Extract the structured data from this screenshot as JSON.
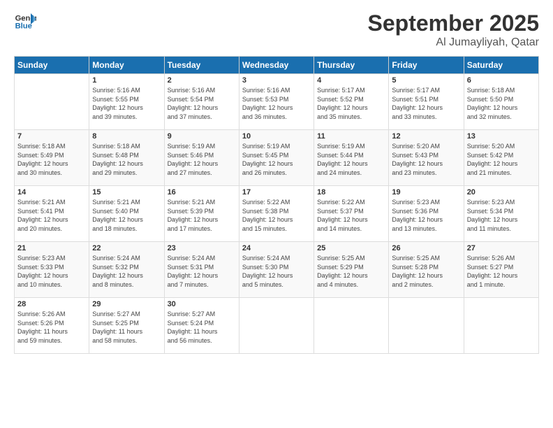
{
  "header": {
    "logo_general": "General",
    "logo_blue": "Blue",
    "month_title": "September 2025",
    "location": "Al Jumayliyah, Qatar"
  },
  "days_of_week": [
    "Sunday",
    "Monday",
    "Tuesday",
    "Wednesday",
    "Thursday",
    "Friday",
    "Saturday"
  ],
  "weeks": [
    [
      {
        "day": "",
        "info": ""
      },
      {
        "day": "1",
        "info": "Sunrise: 5:16 AM\nSunset: 5:55 PM\nDaylight: 12 hours\nand 39 minutes."
      },
      {
        "day": "2",
        "info": "Sunrise: 5:16 AM\nSunset: 5:54 PM\nDaylight: 12 hours\nand 37 minutes."
      },
      {
        "day": "3",
        "info": "Sunrise: 5:16 AM\nSunset: 5:53 PM\nDaylight: 12 hours\nand 36 minutes."
      },
      {
        "day": "4",
        "info": "Sunrise: 5:17 AM\nSunset: 5:52 PM\nDaylight: 12 hours\nand 35 minutes."
      },
      {
        "day": "5",
        "info": "Sunrise: 5:17 AM\nSunset: 5:51 PM\nDaylight: 12 hours\nand 33 minutes."
      },
      {
        "day": "6",
        "info": "Sunrise: 5:18 AM\nSunset: 5:50 PM\nDaylight: 12 hours\nand 32 minutes."
      }
    ],
    [
      {
        "day": "7",
        "info": "Sunrise: 5:18 AM\nSunset: 5:49 PM\nDaylight: 12 hours\nand 30 minutes."
      },
      {
        "day": "8",
        "info": "Sunrise: 5:18 AM\nSunset: 5:48 PM\nDaylight: 12 hours\nand 29 minutes."
      },
      {
        "day": "9",
        "info": "Sunrise: 5:19 AM\nSunset: 5:46 PM\nDaylight: 12 hours\nand 27 minutes."
      },
      {
        "day": "10",
        "info": "Sunrise: 5:19 AM\nSunset: 5:45 PM\nDaylight: 12 hours\nand 26 minutes."
      },
      {
        "day": "11",
        "info": "Sunrise: 5:19 AM\nSunset: 5:44 PM\nDaylight: 12 hours\nand 24 minutes."
      },
      {
        "day": "12",
        "info": "Sunrise: 5:20 AM\nSunset: 5:43 PM\nDaylight: 12 hours\nand 23 minutes."
      },
      {
        "day": "13",
        "info": "Sunrise: 5:20 AM\nSunset: 5:42 PM\nDaylight: 12 hours\nand 21 minutes."
      }
    ],
    [
      {
        "day": "14",
        "info": "Sunrise: 5:21 AM\nSunset: 5:41 PM\nDaylight: 12 hours\nand 20 minutes."
      },
      {
        "day": "15",
        "info": "Sunrise: 5:21 AM\nSunset: 5:40 PM\nDaylight: 12 hours\nand 18 minutes."
      },
      {
        "day": "16",
        "info": "Sunrise: 5:21 AM\nSunset: 5:39 PM\nDaylight: 12 hours\nand 17 minutes."
      },
      {
        "day": "17",
        "info": "Sunrise: 5:22 AM\nSunset: 5:38 PM\nDaylight: 12 hours\nand 15 minutes."
      },
      {
        "day": "18",
        "info": "Sunrise: 5:22 AM\nSunset: 5:37 PM\nDaylight: 12 hours\nand 14 minutes."
      },
      {
        "day": "19",
        "info": "Sunrise: 5:23 AM\nSunset: 5:36 PM\nDaylight: 12 hours\nand 13 minutes."
      },
      {
        "day": "20",
        "info": "Sunrise: 5:23 AM\nSunset: 5:34 PM\nDaylight: 12 hours\nand 11 minutes."
      }
    ],
    [
      {
        "day": "21",
        "info": "Sunrise: 5:23 AM\nSunset: 5:33 PM\nDaylight: 12 hours\nand 10 minutes."
      },
      {
        "day": "22",
        "info": "Sunrise: 5:24 AM\nSunset: 5:32 PM\nDaylight: 12 hours\nand 8 minutes."
      },
      {
        "day": "23",
        "info": "Sunrise: 5:24 AM\nSunset: 5:31 PM\nDaylight: 12 hours\nand 7 minutes."
      },
      {
        "day": "24",
        "info": "Sunrise: 5:24 AM\nSunset: 5:30 PM\nDaylight: 12 hours\nand 5 minutes."
      },
      {
        "day": "25",
        "info": "Sunrise: 5:25 AM\nSunset: 5:29 PM\nDaylight: 12 hours\nand 4 minutes."
      },
      {
        "day": "26",
        "info": "Sunrise: 5:25 AM\nSunset: 5:28 PM\nDaylight: 12 hours\nand 2 minutes."
      },
      {
        "day": "27",
        "info": "Sunrise: 5:26 AM\nSunset: 5:27 PM\nDaylight: 12 hours\nand 1 minute."
      }
    ],
    [
      {
        "day": "28",
        "info": "Sunrise: 5:26 AM\nSunset: 5:26 PM\nDaylight: 11 hours\nand 59 minutes."
      },
      {
        "day": "29",
        "info": "Sunrise: 5:27 AM\nSunset: 5:25 PM\nDaylight: 11 hours\nand 58 minutes."
      },
      {
        "day": "30",
        "info": "Sunrise: 5:27 AM\nSunset: 5:24 PM\nDaylight: 11 hours\nand 56 minutes."
      },
      {
        "day": "",
        "info": ""
      },
      {
        "day": "",
        "info": ""
      },
      {
        "day": "",
        "info": ""
      },
      {
        "day": "",
        "info": ""
      }
    ]
  ]
}
